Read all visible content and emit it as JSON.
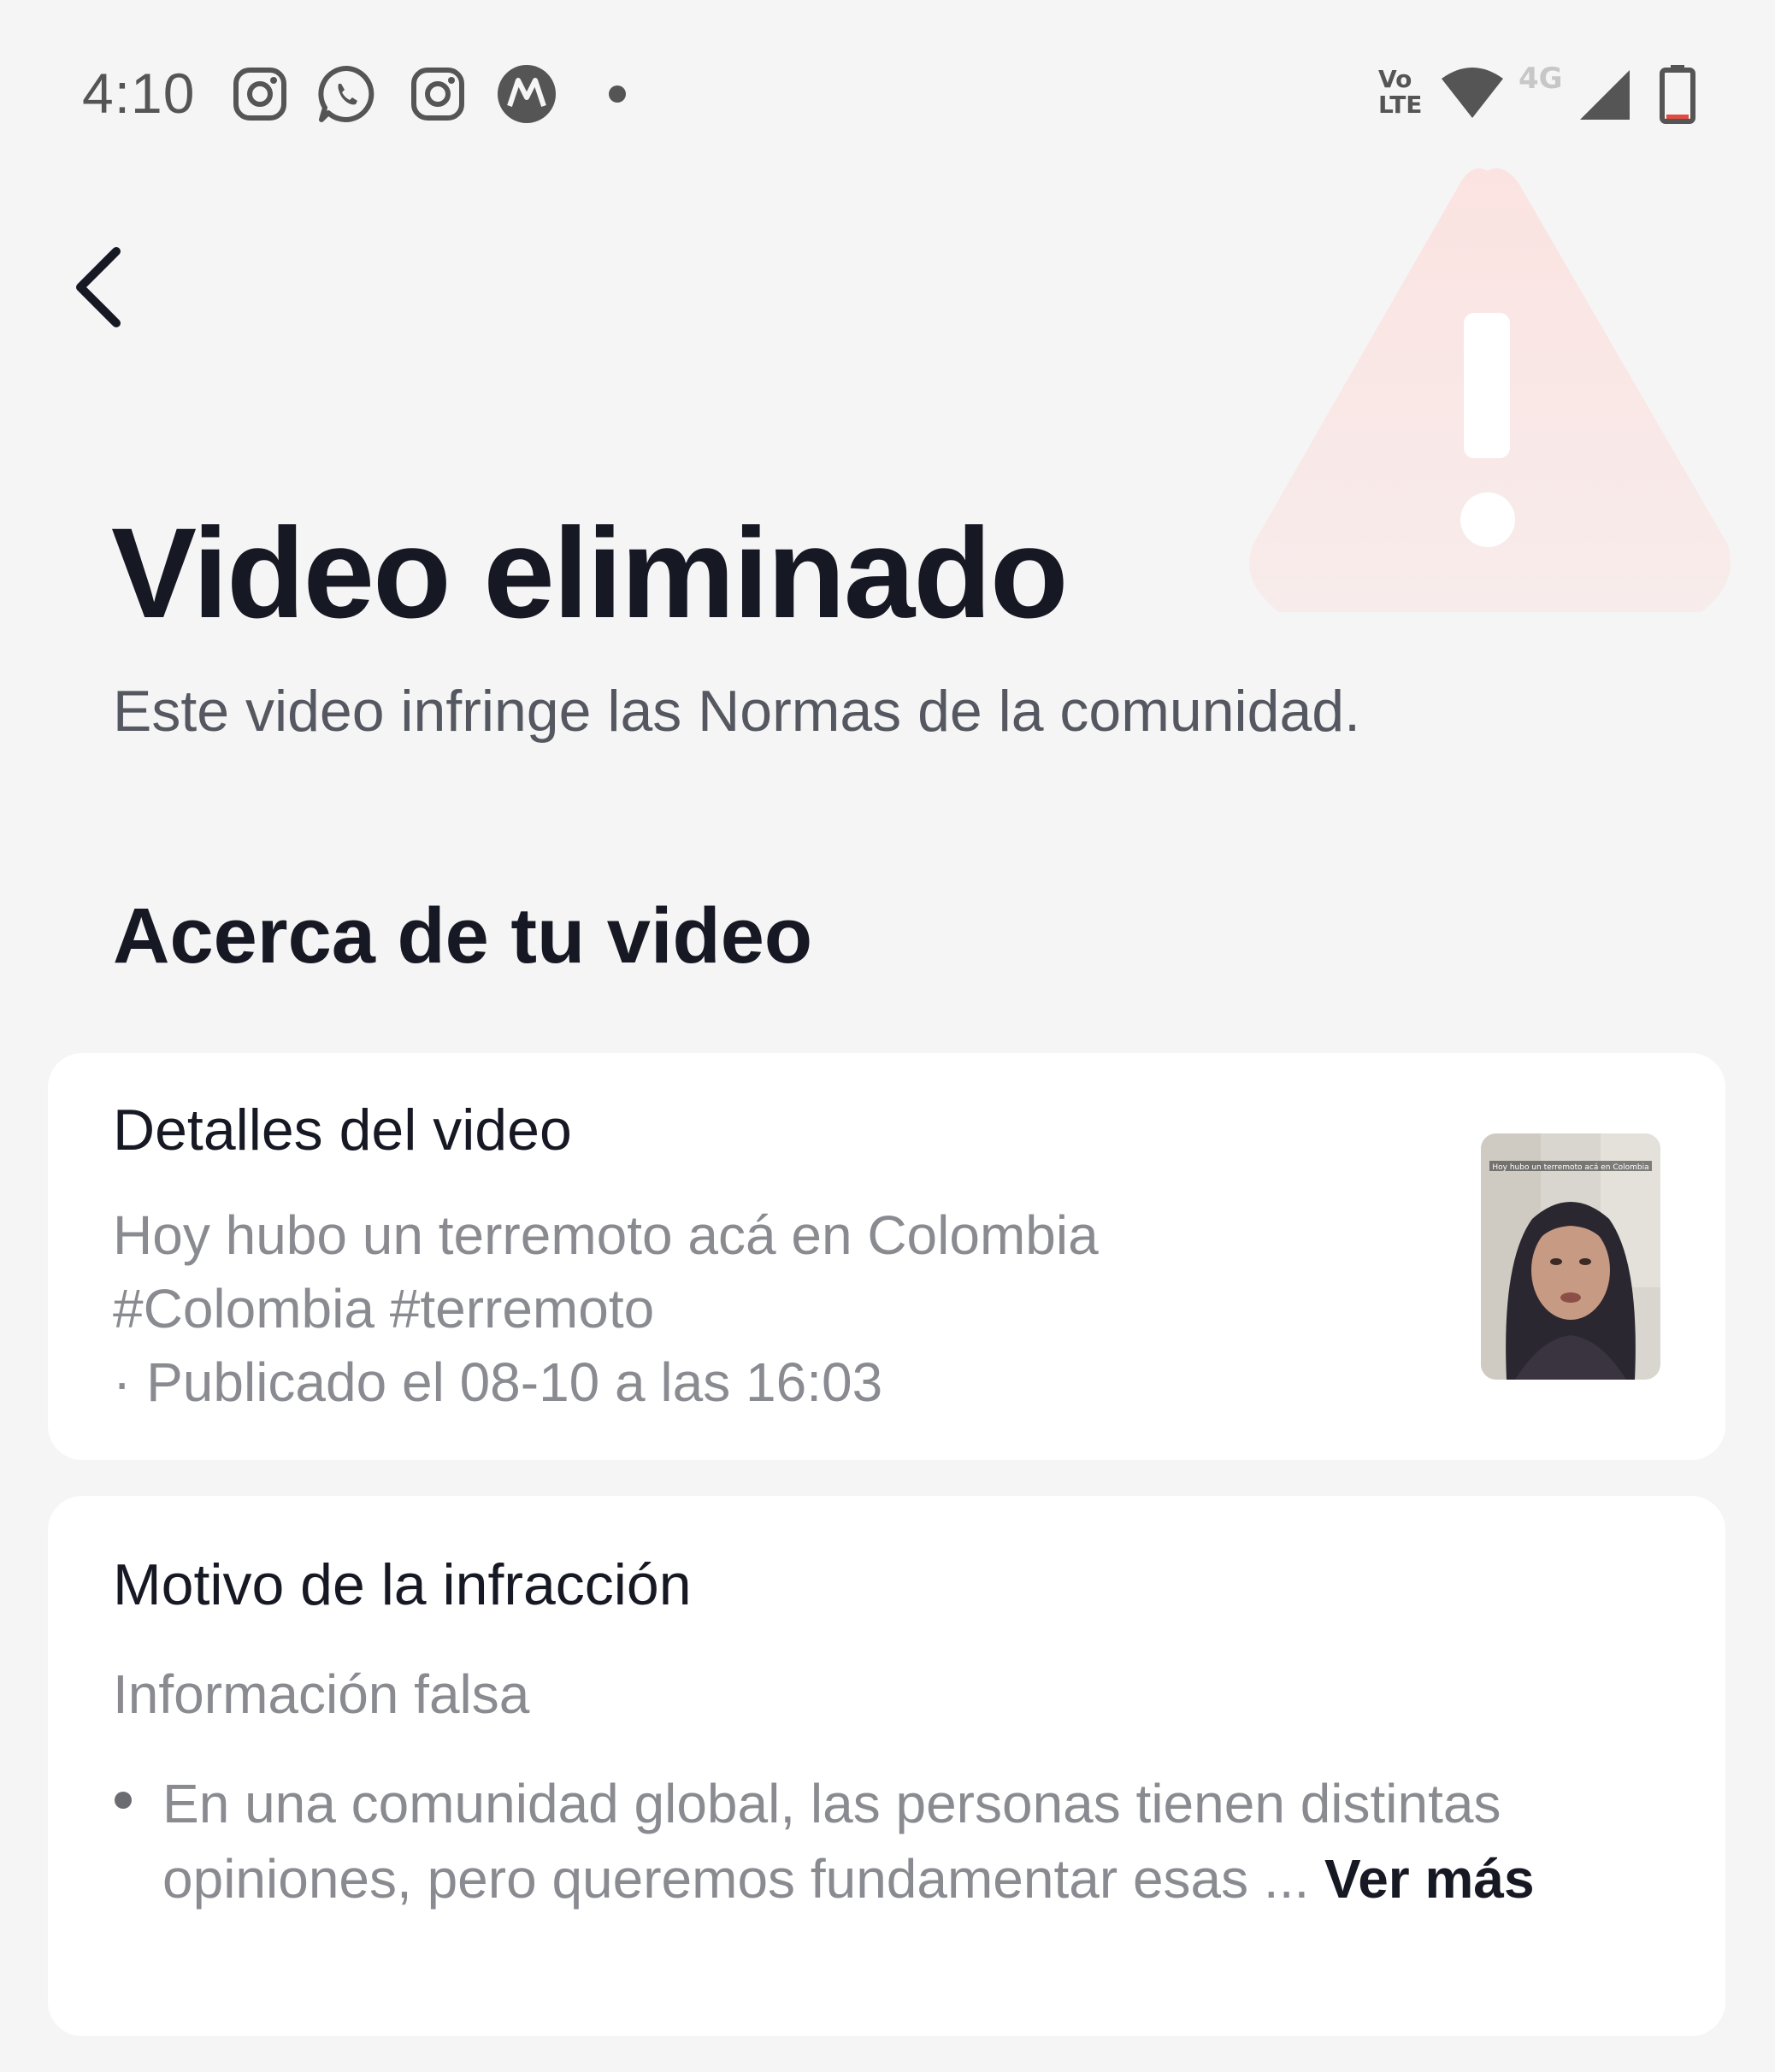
{
  "status_bar": {
    "time": "4:10",
    "notification_icons": [
      "instagram-icon",
      "whatsapp-icon",
      "instagram-icon",
      "motorola-icon",
      "more-notifications-dot"
    ],
    "volte_top": "Vo",
    "volte_bottom": "LTE",
    "network_label": "4G",
    "system_icons": [
      "wifi-icon",
      "cell-signal-icon",
      "battery-icon"
    ]
  },
  "header": {
    "back_icon": "chevron-left-icon",
    "warning_icon": "warning-triangle-icon",
    "title": "Video eliminado",
    "subtitle": "Este video infringe las Normas de la comunidad."
  },
  "section": {
    "heading": "Acerca de tu video"
  },
  "video_details": {
    "title": "Detalles del video",
    "caption_line1": "Hoy hubo un terremoto acá en Colombia",
    "caption_line2": "#Colombia #terremoto",
    "published": "· Publicado el 08-10 a las 16:03",
    "thumbnail_overlay_text": "Hoy hubo un terremoto acá en Colombia"
  },
  "violation": {
    "title": "Motivo de la infracción",
    "reason": "Información falsa",
    "description": "En una comunidad global, las personas tienen distintas opiniones, pero queremos fundamentar esas ... ",
    "see_more": "Ver más"
  },
  "colors": {
    "background": "#f5f5f5",
    "card": "#ffffff",
    "primary_text": "#161823",
    "secondary_text": "#8a8b91",
    "warning_tint": "#fbe3e1"
  }
}
